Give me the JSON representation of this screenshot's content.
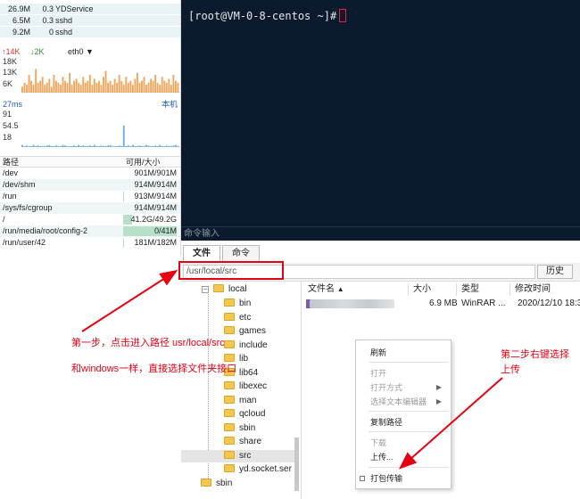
{
  "processes": [
    {
      "mem": "26.9M",
      "cpu": "0.3",
      "name": "YDService"
    },
    {
      "mem": "6.5M",
      "cpu": "0.3",
      "name": "sshd"
    },
    {
      "mem": "9.2M",
      "cpu": "0",
      "name": "sshd"
    }
  ],
  "network": {
    "up": "14K",
    "down": "2K",
    "interface": "eth0",
    "up_arrow": "↑",
    "down_arrow": "↓",
    "dropdown_arrow": "▼",
    "ticks": [
      "18K",
      "13K",
      "6K"
    ]
  },
  "latency": {
    "value": "27ms",
    "host": "本机",
    "ticks": [
      "91",
      "54.5",
      "18"
    ]
  },
  "disk": {
    "header_path": "路径",
    "header_size": "可用/大小",
    "rows": [
      {
        "path": "/dev",
        "size": "901M/901M",
        "used": 0
      },
      {
        "path": "/dev/shm",
        "size": "914M/914M",
        "used": 0
      },
      {
        "path": "/run",
        "size": "913M/914M",
        "used": 0.01
      },
      {
        "path": "/sys/fs/cgroup",
        "size": "914M/914M",
        "used": 0
      },
      {
        "path": "/",
        "size": "41.2G/49.2G",
        "used": 0.16
      },
      {
        "path": "/run/media/root/config-2",
        "size": "0/41M",
        "used": 1
      },
      {
        "path": "/run/user/42",
        "size": "181M/182M",
        "used": 0.01
      }
    ]
  },
  "terminal": {
    "prompt": "[root@VM-0-8-centos ~]#",
    "input_placeholder": "命令输入"
  },
  "tabs": [
    {
      "label": "文件",
      "active": true
    },
    {
      "label": "命令",
      "active": false
    }
  ],
  "pathbar": {
    "path": "/usr/local/src",
    "history_label": "历史"
  },
  "tree": {
    "root": "local",
    "children": [
      "bin",
      "etc",
      "games",
      "include",
      "lib",
      "lib64",
      "libexec",
      "man",
      "qcloud",
      "sbin",
      "share",
      "src",
      "yd.socket.ser"
    ],
    "selected": "src",
    "sibling": "sbin",
    "collapse_symbol": "−"
  },
  "filelist": {
    "columns": [
      "文件名",
      "大小",
      "类型",
      "修改时间"
    ],
    "sort_arrow": "▲",
    "rows": [
      {
        "size": "6.9 MB",
        "type": "WinRAR ...",
        "modified": "2020/12/10 18:3"
      }
    ]
  },
  "context_menu": {
    "items": [
      {
        "label": "刷新",
        "disabled": false
      },
      {
        "label": "打开",
        "disabled": true
      },
      {
        "label": "打开方式",
        "disabled": true,
        "submenu": true
      },
      {
        "label": "选择文本编辑器",
        "disabled": true,
        "submenu": true
      },
      {
        "label": "复制路径",
        "disabled": false
      },
      {
        "label": "下载",
        "disabled": true
      },
      {
        "label": "上传...",
        "disabled": false
      },
      {
        "label": "打包传输",
        "disabled": false,
        "checkbox": true
      }
    ],
    "submenu_arrow": "▶"
  },
  "annotations": {
    "step1_line1": "第一步，点击进入路径 usr/local/src",
    "step1_line2": "和windows一样，直接选择文件夹接口",
    "step2_line1": "第二步右键选择",
    "step2_line2": "上传"
  },
  "colors": {
    "terminal_bg": "#0b1a2c",
    "chart_orange": "#f0a860",
    "chart_blue": "#6fb0e0",
    "annotation_red": "#e60012"
  },
  "chart_data": [
    {
      "type": "bar",
      "title": "",
      "series": [
        {
          "values": [
            3,
            5,
            4,
            9,
            6,
            4,
            12,
            5,
            6,
            8,
            4,
            5,
            7,
            3,
            9,
            6,
            5,
            4,
            8,
            6,
            5,
            10,
            4,
            6,
            7,
            5,
            4,
            8,
            5,
            6,
            9,
            4,
            7,
            5,
            6,
            4,
            8,
            11,
            5,
            6,
            4,
            7,
            5,
            9,
            6,
            4,
            8,
            5,
            6,
            4,
            7,
            10,
            5,
            6,
            8,
            4,
            5,
            7,
            6,
            9,
            5,
            4,
            8,
            6,
            5,
            7,
            4,
            9,
            6,
            5
          ]
        }
      ],
      "ylim": [
        0,
        18
      ],
      "ticks": [
        "18K",
        "13K",
        "6K"
      ]
    },
    {
      "type": "bar",
      "title": "",
      "series": [
        {
          "values": [
            22,
            20,
            21,
            19,
            20,
            22,
            20,
            21,
            19,
            20,
            20,
            21,
            22,
            20,
            19,
            21,
            20,
            20,
            22,
            21,
            20,
            19,
            20,
            21,
            20,
            22,
            20,
            21,
            19,
            20,
            21,
            20,
            22,
            20,
            19,
            21,
            20,
            20,
            21,
            22,
            20,
            19,
            20,
            21,
            20,
            60,
            20,
            21,
            20,
            22,
            19,
            20,
            21,
            20,
            20,
            22,
            21,
            19,
            20,
            21,
            20,
            22,
            20,
            19,
            21,
            20,
            20,
            21,
            22,
            20
          ]
        }
      ],
      "ylim": [
        18,
        91
      ],
      "ticks": [
        "91",
        "54.5",
        "18"
      ]
    }
  ]
}
